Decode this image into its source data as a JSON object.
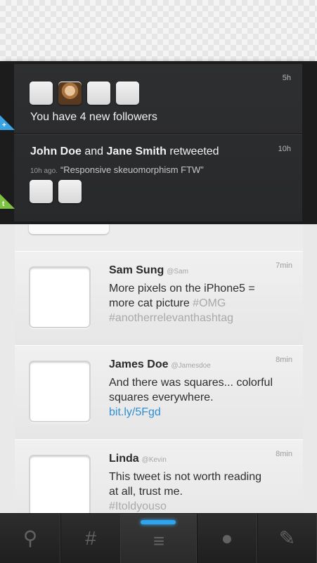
{
  "notifications": [
    {
      "time": "5h",
      "text": "You have 4 new followers",
      "corner_symbol": "+"
    },
    {
      "time": "10h",
      "actor1": "John Doe",
      "conj": "and",
      "actor2": "Jane Smith",
      "action": "retweeted",
      "quote_meta": "10h ago.",
      "quote": "“Responsive skeuomorphism FTW”",
      "corner_symbol": "t"
    }
  ],
  "tweets": [
    {
      "name": "Sam Sung",
      "handle": "@Sam",
      "time": "7min",
      "line1": "More pixels on the iPhone5 =",
      "line2a": "more cat picture",
      "line2b": "#OMG",
      "line3": "#anotherrelevanthashtag"
    },
    {
      "name": "James Doe",
      "handle": "@Jamesdoe",
      "time": "8min",
      "line1": "And there was squares... colorful",
      "line2": "squares everywhere.",
      "link": "bit.ly/5Fgd"
    },
    {
      "name": "Linda",
      "handle": "@Kevin",
      "time": "8min",
      "line1": "This tweet is not worth reading",
      "line2": "at all, trust me.",
      "line3": "#Itoldyouso"
    }
  ],
  "tabs": [
    {
      "icon": "search-icon",
      "glyph": "⚲"
    },
    {
      "icon": "hashtag-icon",
      "glyph": "#"
    },
    {
      "icon": "timeline-icon",
      "glyph": "≡",
      "active": true
    },
    {
      "icon": "profile-icon",
      "glyph": "●"
    },
    {
      "icon": "compose-icon",
      "glyph": "✎"
    }
  ],
  "colors": {
    "accent_blue": "#2fa5f0",
    "corner_blue": "#3aa3e3",
    "corner_green": "#7dc241",
    "link": "#2f8fd1"
  }
}
